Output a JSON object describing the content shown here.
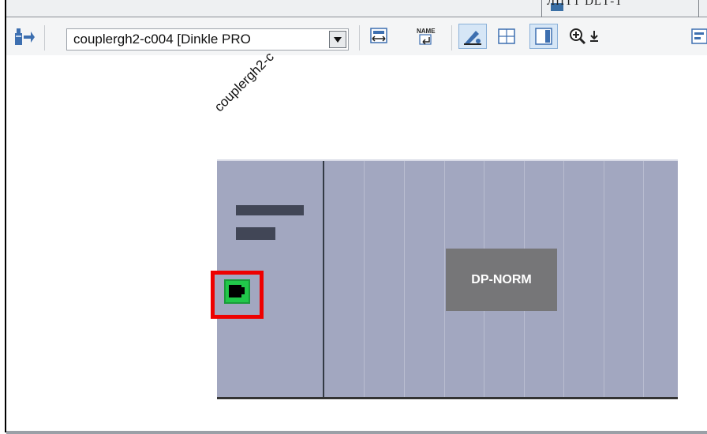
{
  "header": {
    "tab_title": "ЛПТТ DLТ-Т"
  },
  "toolbar": {
    "device_select_value": "couplergh2-c004 [Dinkle PRO",
    "icons": [
      "network-view-icon",
      "show-address-icon",
      "name-icon",
      "edit-icon",
      "grid-icon",
      "layout-icon",
      "zoom-in-icon",
      "zoom-step-icon",
      "overview-icon"
    ]
  },
  "canvas": {
    "device_name": "couplergh2-c",
    "module_label": "DP-NORM"
  },
  "colors": {
    "rack": "#a2a7c0",
    "module": "#767678",
    "port": "#21c84a",
    "highlight": "#ee0000"
  }
}
